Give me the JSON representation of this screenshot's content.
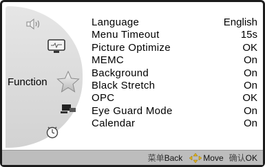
{
  "sidebar": {
    "active_label": "Function",
    "icons": [
      "speaker-icon",
      "picture-icon",
      "star-icon",
      "settings-icon",
      "clock-icon"
    ]
  },
  "menu": {
    "items": [
      {
        "label": "Language",
        "value": "English"
      },
      {
        "label": "Menu Timeout",
        "value": "15s"
      },
      {
        "label": "Picture Optimize",
        "value": "OK"
      },
      {
        "label": "MEMC",
        "value": "On"
      },
      {
        "label": "Background",
        "value": "On"
      },
      {
        "label": "Black Stretch",
        "value": "On"
      },
      {
        "label": "OPC",
        "value": "OK"
      },
      {
        "label": "Eye Guard Mode",
        "value": "On"
      },
      {
        "label": "Calendar",
        "value": "On"
      }
    ]
  },
  "footer": {
    "back_cjk": "菜单",
    "back_label": "Back",
    "move_label": "Move",
    "ok_cjk": "确认",
    "ok_label": "OK"
  },
  "colors": {
    "accent_gold": "#e0b21e",
    "footer_bg": "#bdbdbd",
    "sidebar_bg": "#d9d9d9"
  }
}
